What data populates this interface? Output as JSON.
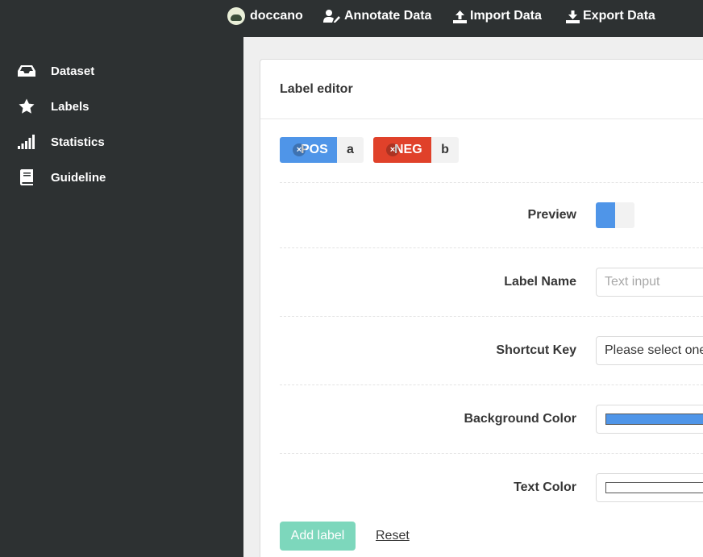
{
  "nav": {
    "brand": "doccano",
    "annotate": "Annotate Data",
    "import": "Import Data",
    "export": "Export Data"
  },
  "sidebar": {
    "items": [
      {
        "label": "Dataset",
        "icon": "inbox-icon"
      },
      {
        "label": "Labels",
        "icon": "star-icon"
      },
      {
        "label": "Statistics",
        "icon": "signal-bars-icon"
      },
      {
        "label": "Guideline",
        "icon": "book-icon"
      }
    ]
  },
  "card": {
    "title": "Label editor"
  },
  "labels": [
    {
      "name": "POS",
      "key": "a",
      "bg": "#4f95e8"
    },
    {
      "name": "NEG",
      "key": "b",
      "bg": "#e0412a"
    }
  ],
  "form": {
    "preview_label": "Preview",
    "name_label": "Label Name",
    "name_placeholder": "Text input",
    "shortcut_label": "Shortcut Key",
    "shortcut_value": "Please select one",
    "bg_label": "Background Color",
    "bg_value": "#4f95e8",
    "text_label": "Text Color",
    "text_value": "#ffffff",
    "add_button": "Add label",
    "reset_button": "Reset"
  }
}
